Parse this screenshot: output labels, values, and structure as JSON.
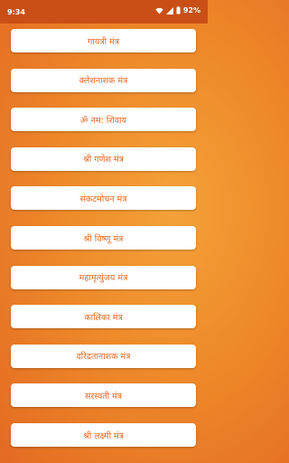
{
  "status_bar": {
    "time": "9:34",
    "battery": "92%",
    "icons": [
      "wifi-icon",
      "signal-icon",
      "battery-icon"
    ]
  },
  "mantras": [
    {
      "label": "गायत्री मंत्र"
    },
    {
      "label": "क्लेशनाशक मंत्र"
    },
    {
      "label": "ॐ नम: शिवाय"
    },
    {
      "label": "श्री गणेश मंत्र"
    },
    {
      "label": "संकटमोचन मंत्र"
    },
    {
      "label": "श्री विष्णू मंत्र"
    },
    {
      "label": "महामृत्युंजय मंत्र"
    },
    {
      "label": "कालिका मंत्र"
    },
    {
      "label": "दरिद्रतानाशक मंत्र"
    },
    {
      "label": "सरस्वती मंत्र"
    },
    {
      "label": "श्री लक्ष्मी मंत्र"
    }
  ],
  "colors": {
    "background": "#ee8a2a",
    "status_bar": "#c94f16",
    "button_text": "#e8661c",
    "button_bg": "#ffffff"
  }
}
